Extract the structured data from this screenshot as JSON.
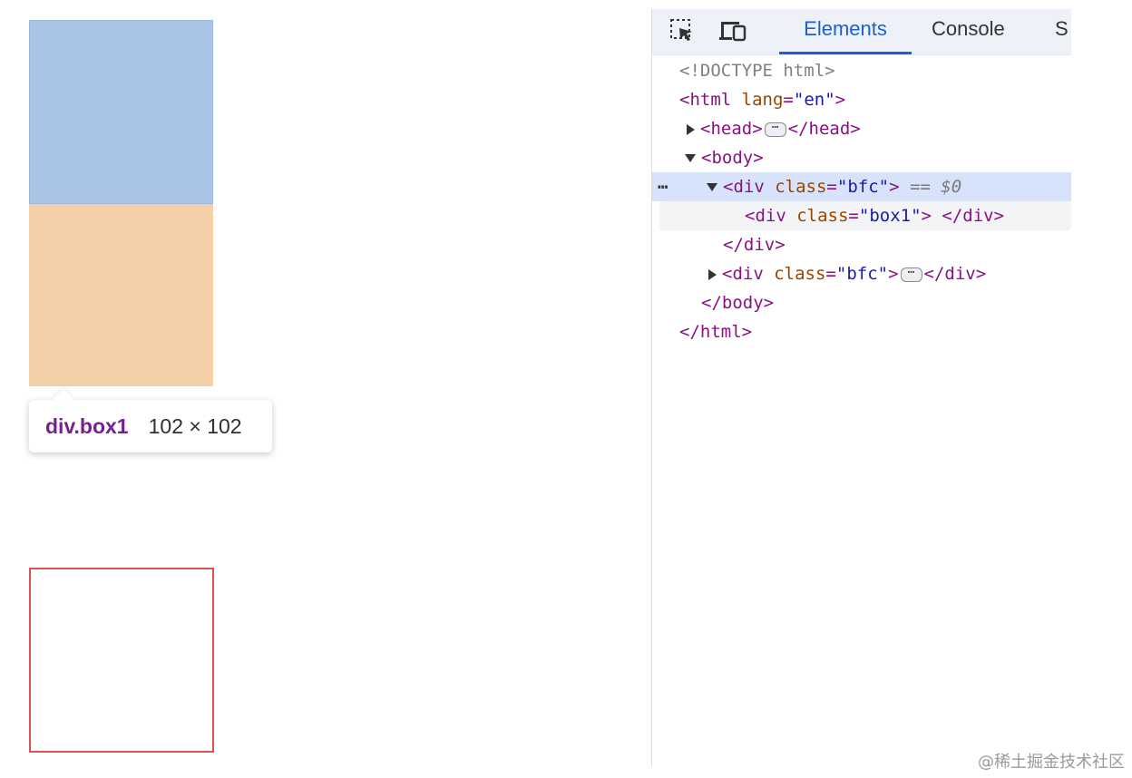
{
  "tooltip": {
    "element": "div.box1",
    "size": "102 × 102"
  },
  "devtools": {
    "tabs": [
      "Elements",
      "Console",
      "S"
    ],
    "icons": [
      "inspect-element-icon",
      "device-toolbar-icon"
    ],
    "lines": {
      "doctype": "<!DOCTYPE html>",
      "html_open_tag": "<html",
      "html_attr_name": "lang",
      "html_attr_value": "\"en\"",
      "head_open": "<head>",
      "head_close": "</head>",
      "body_open": "<body>",
      "div_tag": "<div",
      "class_attr": "class",
      "bfc_value": "\"bfc\"",
      "selected_suffix": "== $0",
      "box1_value": "\"box1\"",
      "div_close": "</div>",
      "body_close": "</body>",
      "html_close": "</html>"
    },
    "ellipsis": "⋯",
    "row_dots": "⋯"
  },
  "watermark": "@稀土掘金技术社区",
  "colors": {
    "blue_box": "#a9c4e6",
    "orange_box": "#f5cfa7",
    "red_border": "#d9534f",
    "accent": "#1a5fd6"
  }
}
